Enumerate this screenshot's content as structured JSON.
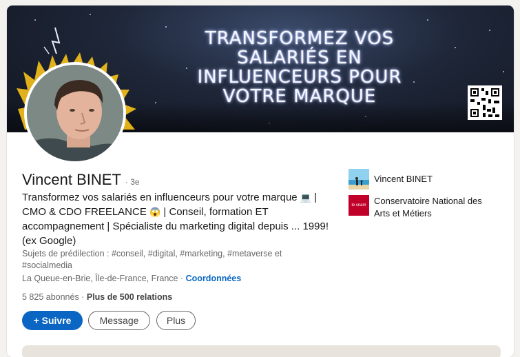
{
  "banner": {
    "lines": [
      "TRANSFORMEZ VOS",
      "SALARIÉS EN",
      "INFLUENCEURS POUR",
      "VOTRE MARQUE"
    ]
  },
  "profile": {
    "name": "Vincent BINET",
    "degree": "· 3e",
    "headline_part1": "Transformez vos salariés en influenceurs pour votre marque",
    "headline_part2": "| CMO & CDO FREELANCE",
    "headline_part3": "| Conseil, formation ET accompagnement | Spécialiste du marketing digital depuis ... 1999! (ex Google)",
    "topics": "Sujets de prédilection : #conseil, #digital, #marketing, #metaverse et #socialmedia",
    "location": "La Queue-en-Brie, Île-de-France, France",
    "location_sep": "·",
    "contact_link": "Coordonnées",
    "followers": "5 825 abonnés",
    "stats_sep": "·",
    "connections": "Plus de 500 relations"
  },
  "actions": {
    "follow": "+ Suivre",
    "message": "Message",
    "more": "Plus"
  },
  "sidebar": {
    "items": [
      {
        "label": "Vincent BINET",
        "logo": "beach-photo-logo"
      },
      {
        "label": "Conservatoire National des Arts et Métiers",
        "logo": "cnam-logo",
        "logo_text": "le cnam"
      }
    ]
  },
  "icons": {
    "headline_emoji_1": "laptop-icon",
    "headline_emoji_2": "shocked-face-icon"
  },
  "colors": {
    "accent": "#0a66c2",
    "cnam_red": "#c1002a"
  }
}
